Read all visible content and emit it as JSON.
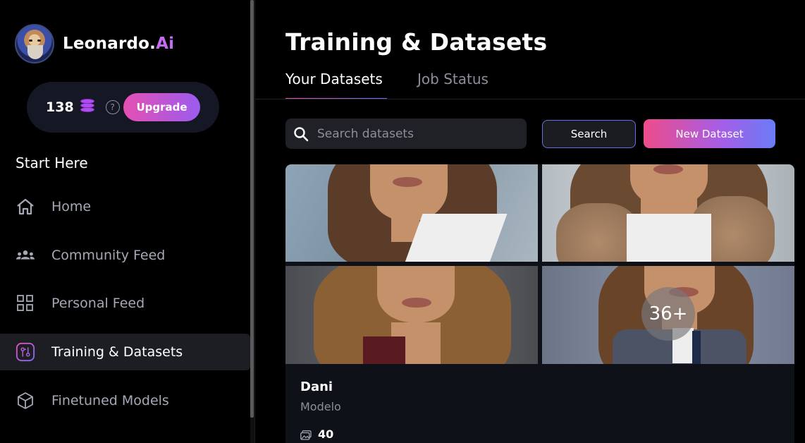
{
  "brand": {
    "name": "Leonardo.",
    "accent": "Ai",
    "accent_color": "#c46bf2",
    "logo_icon": "wizard-avatar"
  },
  "tokens": {
    "count": "138",
    "icon": "coins-icon",
    "help_icon": "question-circle-icon",
    "upgrade_label": "Upgrade"
  },
  "sidebar": {
    "section_title": "Start Here",
    "items": [
      {
        "label": "Home",
        "icon": "home-icon",
        "active": false
      },
      {
        "label": "Community Feed",
        "icon": "community-icon",
        "active": false
      },
      {
        "label": "Personal Feed",
        "icon": "grid-icon",
        "active": false
      },
      {
        "label": "Training & Datasets",
        "icon": "training-icon",
        "active": true
      },
      {
        "label": "Finetuned Models",
        "icon": "cube-icon",
        "active": false
      }
    ]
  },
  "main": {
    "title": "Training & Datasets",
    "tabs": [
      {
        "label": "Your Datasets",
        "active": true
      },
      {
        "label": "Job Status",
        "active": false
      }
    ],
    "search": {
      "placeholder": "Search datasets",
      "value": "",
      "button_label": "Search"
    },
    "new_dataset_label": "New Dataset",
    "dataset": {
      "title": "Dani",
      "subtitle": "Modelo",
      "more_badge": "36+",
      "image_count": "40"
    }
  },
  "colors": {
    "accent_pink": "#e64fb2",
    "accent_purple": "#9a5cf0",
    "accent_blue": "#6a7cf5",
    "background": "#000000"
  }
}
